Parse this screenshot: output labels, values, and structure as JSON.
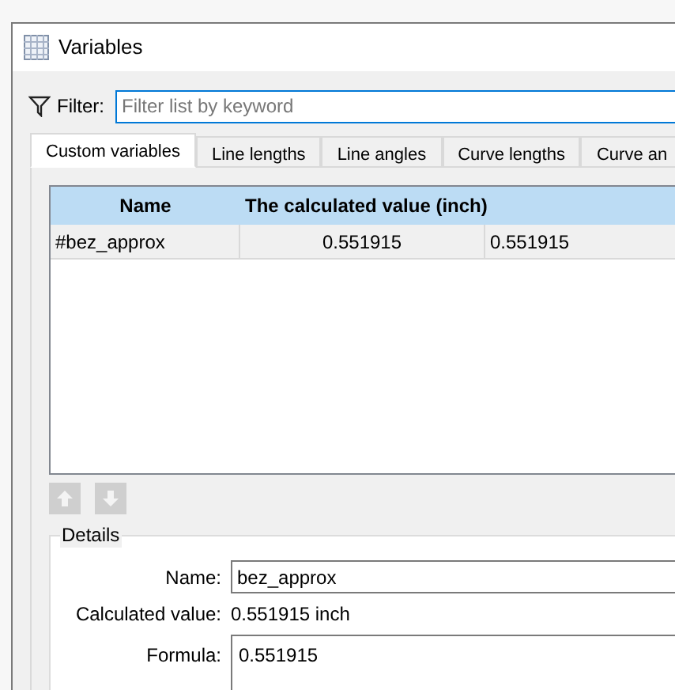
{
  "window": {
    "title": "Variables"
  },
  "filter": {
    "label": "Filter:",
    "placeholder": "Filter list by keyword"
  },
  "tabs": [
    {
      "label": "Custom variables",
      "selected": true
    },
    {
      "label": "Line lengths",
      "selected": false
    },
    {
      "label": "Line angles",
      "selected": false
    },
    {
      "label": "Curve lengths",
      "selected": false
    },
    {
      "label": "Curve an",
      "selected": false
    }
  ],
  "table": {
    "columns": [
      "Name",
      "The calculated value (inch)"
    ],
    "rows": [
      {
        "cells": [
          "#bez_approx",
          "0.551915",
          "0.551915"
        ],
        "selected": true
      }
    ]
  },
  "move_buttons": [
    {
      "kind": "up",
      "disabled": true
    },
    {
      "kind": "down",
      "disabled": true
    }
  ],
  "details": {
    "title": "Details",
    "name_label": "Name:",
    "name_value": "bez_approx",
    "calc_label": "Calculated value:",
    "calc_value": "0.551915 inch",
    "formula_label": "Formula:",
    "formula_value": "0.551915"
  }
}
